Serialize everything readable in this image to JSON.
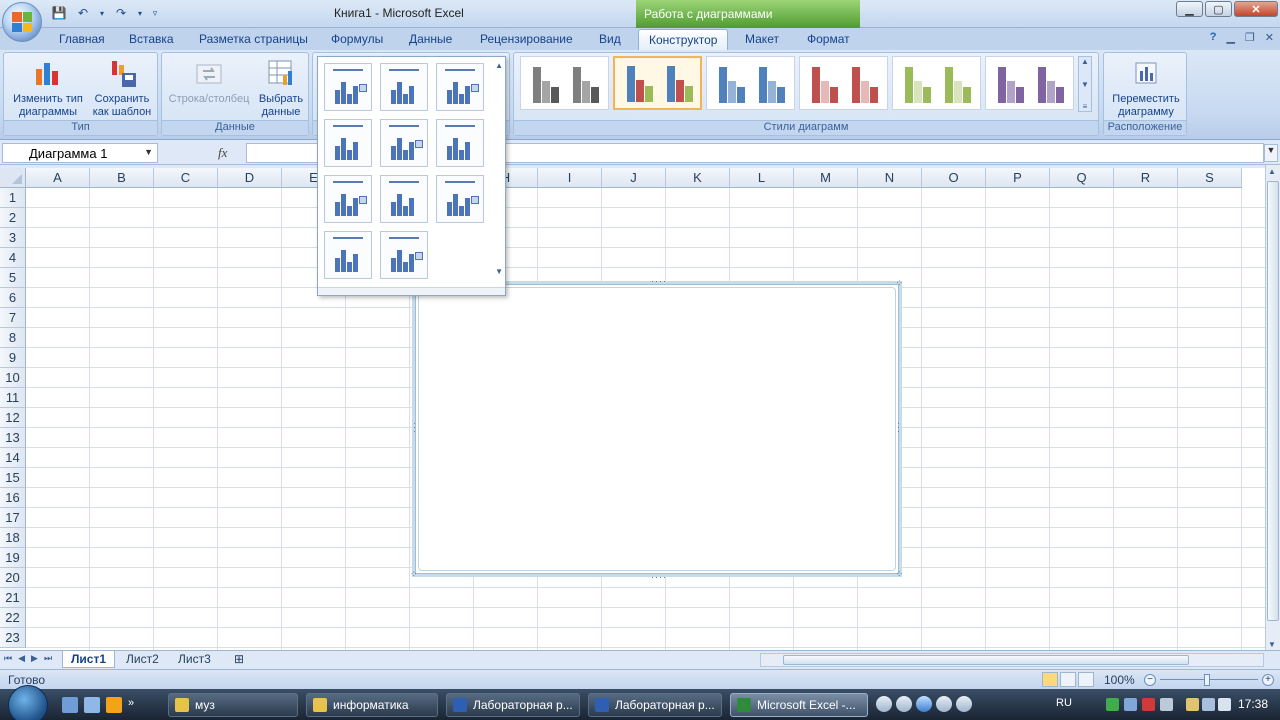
{
  "window": {
    "title": "Книга1 - Microsoft Excel",
    "context_title": "Работа с диаграммами"
  },
  "ribbon_tabs": [
    "Главная",
    "Вставка",
    "Разметка страницы",
    "Формулы",
    "Данные",
    "Рецензирование",
    "Вид",
    "Конструктор",
    "Макет",
    "Формат"
  ],
  "active_tab": "Конструктор",
  "ribbon": {
    "type_group": {
      "label": "Тип",
      "change_type_label": "Изменить тип диаграммы",
      "save_template_label": "Сохранить как шаблон"
    },
    "data_group": {
      "label": "Данные",
      "row_column_label": "Строка/столбец",
      "select_data_label": "Выбрать данные"
    },
    "styles_group": {
      "label": "Стили диаграмм"
    },
    "location_group": {
      "label": "Расположение",
      "move_chart_label": "Переместить диаграмму"
    },
    "style_colors": [
      "#7f7f7f",
      "#4f81bd",
      "#4f81bd",
      "#c0504d",
      "#9bbb59",
      "#8064a2"
    ]
  },
  "formula_bar": {
    "name_box": "Диаграмма 1",
    "fx": "fx",
    "formula": ""
  },
  "grid": {
    "columns": [
      "A",
      "B",
      "C",
      "D",
      "E",
      "F",
      "G",
      "H",
      "I",
      "J",
      "K",
      "L",
      "M",
      "N",
      "O",
      "P",
      "Q",
      "R",
      "S"
    ],
    "rows": [
      "1",
      "2",
      "3",
      "4",
      "5",
      "6",
      "7",
      "8",
      "9",
      "10",
      "11",
      "12",
      "13",
      "14",
      "15",
      "16",
      "17",
      "18",
      "19",
      "20",
      "21",
      "22",
      "23"
    ]
  },
  "sheets": [
    "Лист1",
    "Лист2",
    "Лист3"
  ],
  "active_sheet": "Лист1",
  "status": {
    "text": "Готово",
    "zoom": "100%"
  },
  "taskbar": {
    "items": [
      "муз",
      "информатика",
      "Лабораторная р...",
      "Лабораторная р...",
      "Microsoft Excel -..."
    ],
    "active_item": "Microsoft Excel -...",
    "language": "RU",
    "clock": "17:38"
  }
}
